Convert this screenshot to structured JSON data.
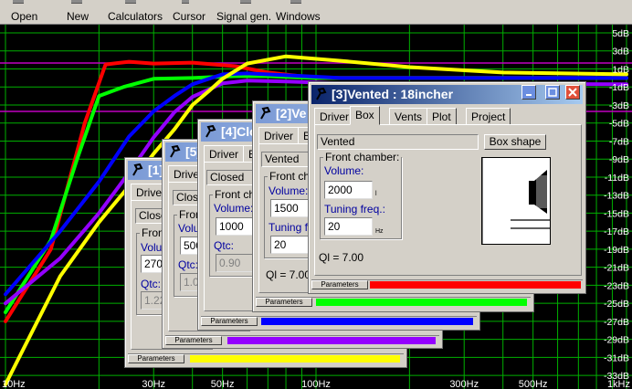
{
  "toolbar": {
    "items": [
      {
        "label": "Open",
        "icon": "open-icon"
      },
      {
        "label": "New",
        "icon": "new-icon"
      },
      {
        "label": "Calculators",
        "icon": "calculator-icon"
      },
      {
        "label": "Cursor",
        "icon": "cursor-icon"
      },
      {
        "label": "Signal gen.",
        "icon": "signal-generator-icon"
      },
      {
        "label": "Windows",
        "icon": "windows-icon"
      }
    ]
  },
  "chart_data": {
    "type": "line",
    "xscale": "log",
    "xlim": [
      10,
      1000
    ],
    "ylim": [
      -34,
      5
    ],
    "x_ticks": [
      "10Hz",
      "30Hz",
      "50Hz",
      "100Hz",
      "300Hz",
      "500Hz",
      "1kHz"
    ],
    "y_ticks": [
      "5dB",
      "3dB",
      "1dB",
      "-1dB",
      "-3dB",
      "-5dB",
      "-7dB",
      "-9dB",
      "-11dB",
      "-13dB",
      "-15dB",
      "-17dB",
      "-19dB",
      "-21dB",
      "-23dB",
      "-25dB",
      "-27dB",
      "-29dB",
      "-31dB",
      "-33dB"
    ],
    "background": "#000000",
    "grid_color": "#00b000",
    "grid": true,
    "series": [
      {
        "color": "#ff0000",
        "x": [
          10,
          14,
          18,
          21,
          25,
          30,
          40,
          55,
          70,
          100,
          200,
          1000
        ],
        "y": [
          -27,
          -19,
          -5,
          1.5,
          1.8,
          1.6,
          1.7,
          1.3,
          0.6,
          0,
          0,
          0
        ]
      },
      {
        "color": "#00ff00",
        "x": [
          10,
          14,
          17,
          20,
          24,
          30,
          40,
          55,
          70,
          100,
          200,
          1000
        ],
        "y": [
          -26,
          -18,
          -9,
          -2,
          -1,
          -0.1,
          0,
          0.2,
          0.2,
          0,
          0,
          0
        ]
      },
      {
        "color": "#0000ff",
        "x": [
          10,
          15,
          20,
          25,
          30,
          35,
          40,
          50,
          60,
          80,
          120,
          1000
        ],
        "y": [
          -24,
          -17,
          -11.5,
          -6.5,
          -3.7,
          -2,
          -0.7,
          0.4,
          0.5,
          0.3,
          0,
          0
        ]
      },
      {
        "color": "#9400ff",
        "x": [
          10,
          15,
          20,
          25,
          30,
          35,
          40,
          50,
          60,
          80,
          120,
          1000
        ],
        "y": [
          -25,
          -20,
          -15,
          -10.5,
          -6.6,
          -3.8,
          -2.1,
          -0.6,
          -0.3,
          -0.4,
          -0.6,
          -0.7
        ]
      },
      {
        "color": "#ffff00",
        "x": [
          10,
          15,
          20,
          25,
          30,
          35,
          40,
          45,
          50,
          60,
          80,
          120,
          200,
          400,
          1000
        ],
        "y": [
          -34,
          -22,
          -16,
          -12,
          -8.4,
          -5.7,
          -3,
          -1.5,
          -0.1,
          1.6,
          2.4,
          1.9,
          1.2,
          0.6,
          0.4
        ]
      }
    ]
  },
  "purple_line_color": "#c000c0",
  "windows": [
    {
      "title": "[1]",
      "color": "#ffff00",
      "tabs": [
        "Driver"
      ],
      "mode": "Close",
      "group": "Fron",
      "vol_lbl": "Volu",
      "vol": "270",
      "q_lbl": "Qtc:",
      "q": "1.22",
      "params": "Parameters"
    },
    {
      "title": "[5]",
      "color": "#9400ff",
      "tabs": [
        "Driver"
      ],
      "mode": "Close",
      "group": "Fron",
      "vol_lbl": "Volu",
      "vol": "500",
      "q_lbl": "Qtc:",
      "q": "1.09",
      "params": "Parameters"
    },
    {
      "title": "[4]Clo",
      "color": "#0000ff",
      "tabs": [
        "Driver",
        "B"
      ],
      "mode": "Closed",
      "group": "Front cha",
      "vol_lbl": "Volume:",
      "vol": "1000",
      "q_lbl": "Qtc:",
      "q": "0.90",
      "params": "Parameters"
    },
    {
      "title": "[2]Ve",
      "color": "#00ff00",
      "tabs": [
        "Driver",
        "B"
      ],
      "mode": "Vented",
      "group": "Front ch",
      "vol_lbl": "Volume:",
      "vol": "1500",
      "tun_lbl": "Tuning fr",
      "tun": "20",
      "ql": "Ql = 7.00",
      "params": "Parameters"
    },
    {
      "title": "[3]Vented : 18incher",
      "color": "#ff0000",
      "tabs": [
        "Driver",
        "Box",
        "Vents",
        "Plot",
        "Project"
      ],
      "mode": "Vented",
      "btn": "Box shape",
      "group": "Front chamber:",
      "vol_lbl": "Volume:",
      "vol": "2000",
      "vol_unit": "l",
      "tun_lbl": "Tuning freq.:",
      "tun": "20",
      "tun_unit": "Hz",
      "ql": "Ql = 7.00",
      "params": "Parameters"
    }
  ]
}
